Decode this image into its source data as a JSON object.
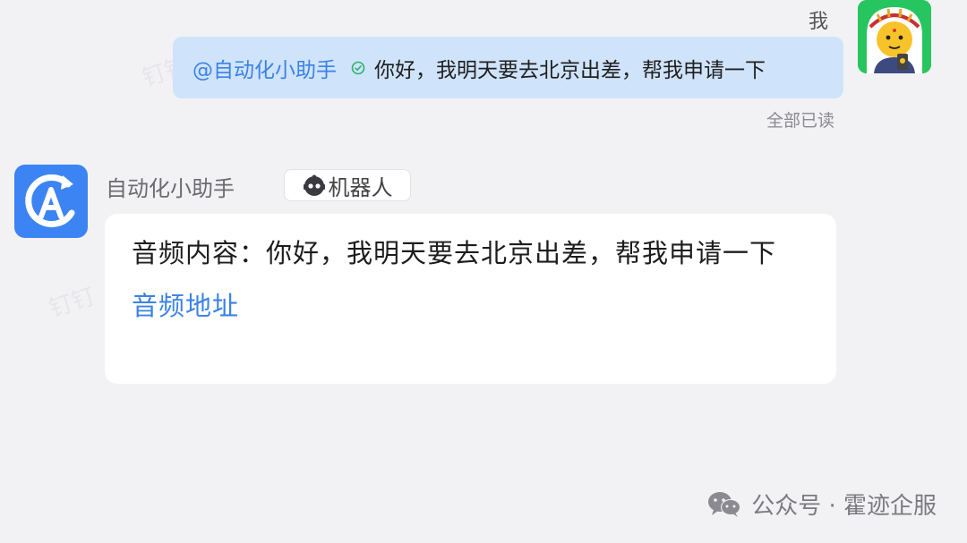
{
  "watermark": {
    "text": "钉钉"
  },
  "outgoing": {
    "sender_name": "我",
    "mention": "@自动化小助手",
    "message": "你好，我明天要去北京出差，帮我申请一下",
    "read_status": "全部已读"
  },
  "incoming": {
    "sender_name": "自动化小助手",
    "badge": "机器人",
    "message": "音频内容：你好，我明天要去北京出差，帮我申请一下",
    "link": "音频地址"
  },
  "footer": {
    "text": "公众号 · 霍迹企服"
  },
  "colors": {
    "accent": "#3b82e6",
    "outgoing_bubble": "#cfe3fb",
    "bot_avatar": "#3c84f4",
    "background": "#f2f2f5",
    "check": "#2db36b"
  },
  "icons": {
    "check": "check-circle-icon",
    "robot": "robot-icon",
    "wechat": "wechat-icon",
    "bot_avatar": "automation-logo-icon"
  }
}
